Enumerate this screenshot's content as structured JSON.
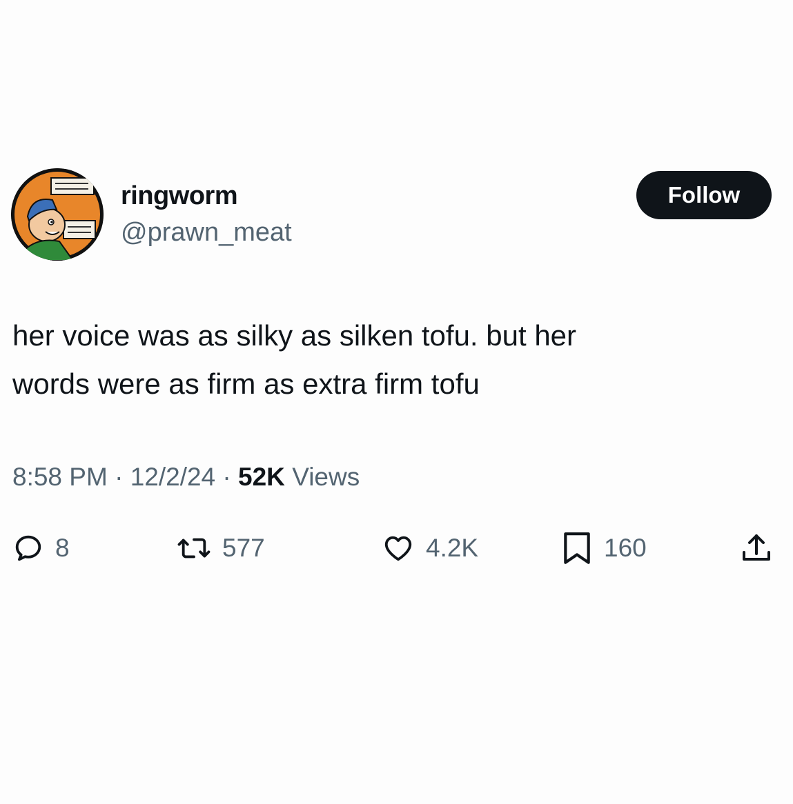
{
  "user": {
    "display_name": "ringworm",
    "handle": "@prawn_meat",
    "avatar_icon": "cartoon-character-avatar"
  },
  "follow_label": "Follow",
  "tweet": {
    "text": "her voice was as silky as silken tofu. but her\nwords were as firm as extra firm tofu"
  },
  "meta": {
    "time": "8:58 PM",
    "separator": "·",
    "date": "12/2/24",
    "views_count": "52K",
    "views_label": "Views"
  },
  "actions": {
    "reply": {
      "icon": "reply-icon",
      "count": "8"
    },
    "retweet": {
      "icon": "retweet-icon",
      "count": "577"
    },
    "like": {
      "icon": "heart-icon",
      "count": "4.2K"
    },
    "bookmark": {
      "icon": "bookmark-icon",
      "count": "160"
    },
    "share": {
      "icon": "share-icon"
    }
  },
  "colors": {
    "text_primary": "#0f1419",
    "text_secondary": "#536471",
    "button_bg": "#0f1419",
    "background": "#fdfdfd"
  }
}
